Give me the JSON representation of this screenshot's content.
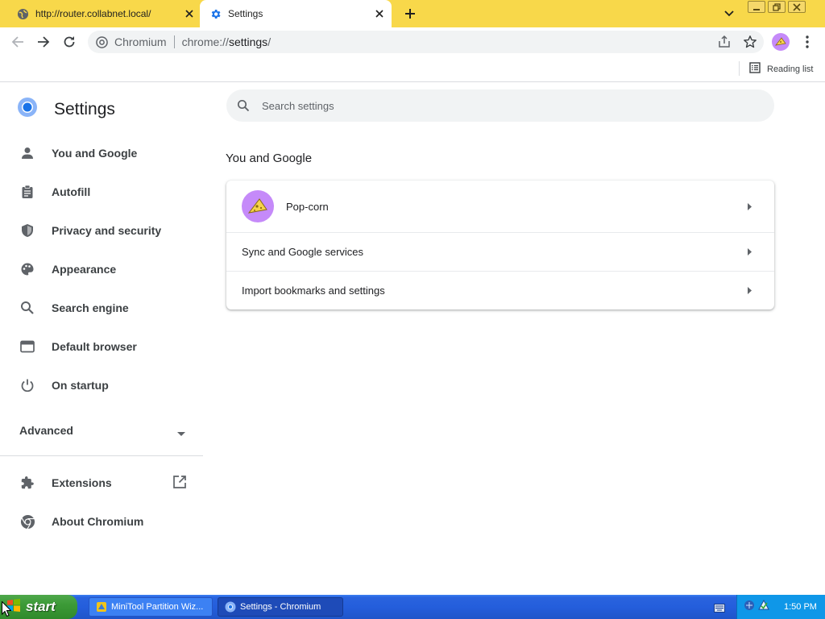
{
  "tabs": [
    {
      "title": "http://router.collabnet.local/",
      "favicon": "globe-icon"
    },
    {
      "title": "Settings",
      "favicon": "gear-icon",
      "active": true
    }
  ],
  "toolbar": {
    "site_label": "Chromium",
    "url_scheme": "chrome://",
    "url_host": "settings",
    "url_path": "/"
  },
  "bookmarks": {
    "reading_list_label": "Reading list"
  },
  "sidebar": {
    "title": "Settings",
    "items": [
      {
        "label": "You and Google",
        "icon": "person-icon"
      },
      {
        "label": "Autofill",
        "icon": "clipboard-icon"
      },
      {
        "label": "Privacy and security",
        "icon": "shield-icon"
      },
      {
        "label": "Appearance",
        "icon": "palette-icon"
      },
      {
        "label": "Search engine",
        "icon": "search-icon"
      },
      {
        "label": "Default browser",
        "icon": "browser-icon"
      },
      {
        "label": "On startup",
        "icon": "power-icon"
      }
    ],
    "advanced_label": "Advanced",
    "extensions_label": "Extensions",
    "about_label": "About Chromium"
  },
  "search": {
    "placeholder": "Search settings"
  },
  "main": {
    "section_title": "You and Google",
    "profile_name": "Pop-corn",
    "sync_label": "Sync and Google services",
    "import_label": "Import bookmarks and settings"
  },
  "taskbar": {
    "start_label": "start",
    "tasks": [
      {
        "label": "MiniTool Partition Wiz...",
        "icon": "minitool-icon"
      },
      {
        "label": "Settings - Chromium",
        "icon": "chromium-icon",
        "active": true
      }
    ],
    "clock": "1:50 PM"
  },
  "colors": {
    "tab_strip": "#f8d84a",
    "accent": "#1a73e8",
    "avatar": "#c58af9",
    "taskbar": "#245edc",
    "start_button": "#3c9a37"
  }
}
